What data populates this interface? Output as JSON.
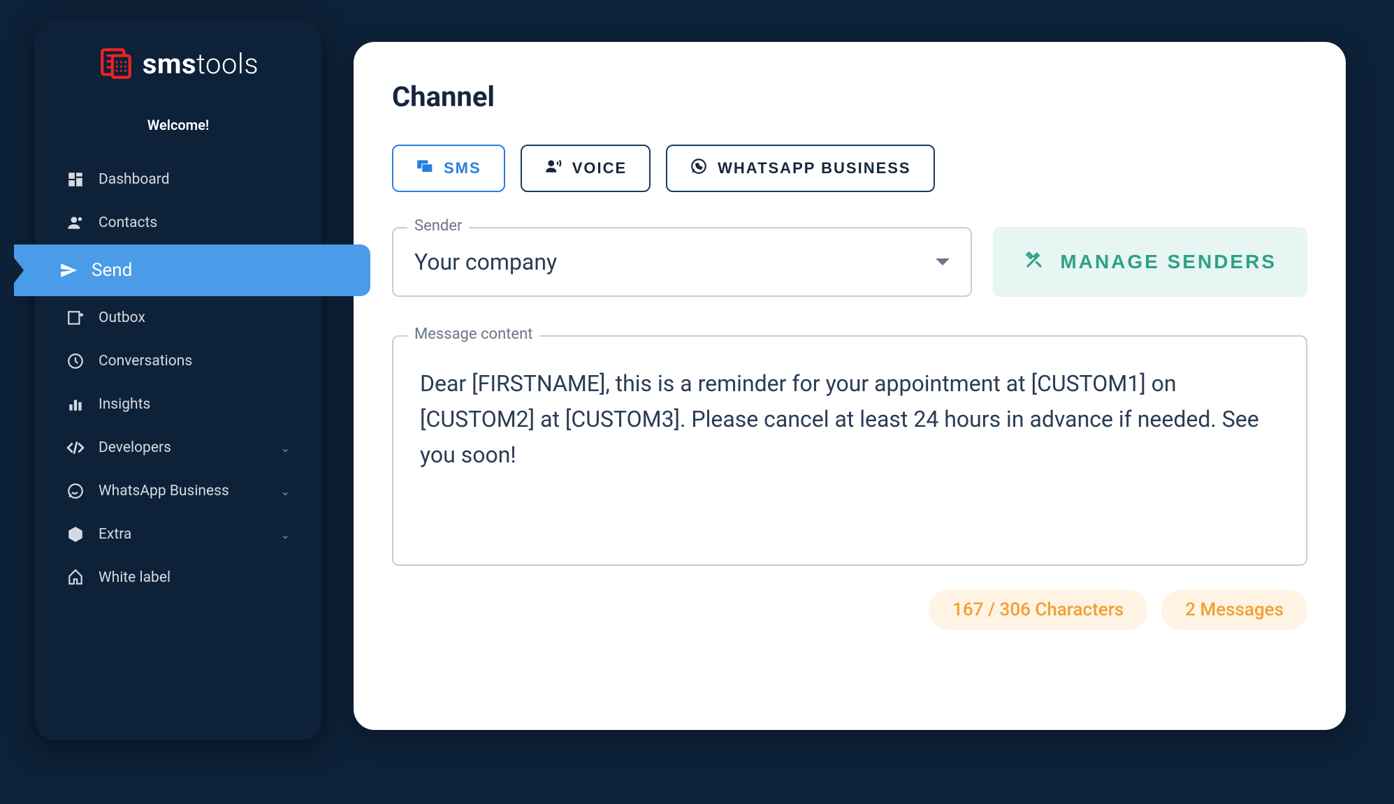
{
  "logo": {
    "prefix": "sms",
    "suffix": "tools"
  },
  "welcome": "Welcome!",
  "nav": {
    "dashboard": "Dashboard",
    "contacts": "Contacts",
    "send": "Send",
    "outbox": "Outbox",
    "conversations": "Conversations",
    "insights": "Insights",
    "developers": "Developers",
    "whatsapp_business": "WhatsApp Business",
    "extra": "Extra",
    "white_label": "White label"
  },
  "page": {
    "title": "Channel"
  },
  "tabs": {
    "sms": "SMS",
    "voice": "VOICE",
    "whatsapp": "WHATSAPP BUSINESS"
  },
  "sender": {
    "label": "Sender",
    "value": "Your company",
    "manage_button": "MANAGE SENDERS"
  },
  "message": {
    "label": "Message content",
    "content": "Dear [FIRSTNAME], this is a reminder for your appointment at [CUSTOM1] on [CUSTOM2] at [CUSTOM3]. Please cancel at least 24 hours in advance if needed. See you soon!"
  },
  "footer": {
    "characters": "167 / 306 Characters",
    "messages": "2 Messages"
  }
}
